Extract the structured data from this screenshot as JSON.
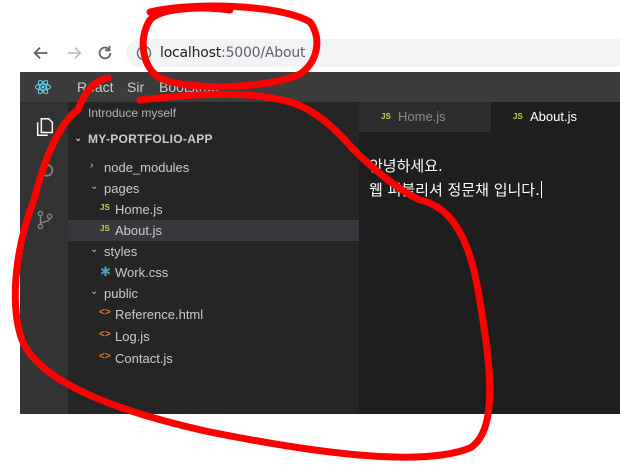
{
  "browser": {
    "url_host": "localhost",
    "url_path": ":5000/About"
  },
  "app": {
    "menu": [
      "React",
      "Sir",
      "Bootstrap"
    ],
    "sidebar_header": "Introduce myself",
    "project_title": "MY-PORTFOLIO-APP",
    "tree": [
      {
        "label": "node_modules",
        "type": "folder",
        "expanded": false
      },
      {
        "label": "pages",
        "type": "folder",
        "expanded": true
      },
      {
        "label": "Home.js",
        "type": "js"
      },
      {
        "label": "About.js",
        "type": "js",
        "selected": true
      },
      {
        "label": "styles",
        "type": "folder",
        "expanded": true
      },
      {
        "label": "Work.css",
        "type": "css"
      },
      {
        "label": "public",
        "type": "folder",
        "expanded": true
      },
      {
        "label": "Reference.html",
        "type": "html"
      },
      {
        "label": "Log.js",
        "type": "html"
      },
      {
        "label": "Contact.js",
        "type": "html"
      }
    ],
    "tabs": [
      {
        "label": "Home.js",
        "active": false
      },
      {
        "label": "About.js",
        "active": true
      }
    ],
    "content_lines": [
      "안녕하세요.",
      "웹 퍼블리셔 정문채 입니다."
    ]
  },
  "icons": {
    "back": "arrow-left-icon",
    "forward": "arrow-right-icon",
    "reload": "reload-icon",
    "info": "info-icon",
    "logo": "react-logo-icon",
    "explorer": "files-icon",
    "search": "search-icon",
    "scm": "source-control-icon",
    "js_badge": "JS",
    "css_badge": "✱",
    "html_badge": "<>"
  },
  "colors": {
    "annotation": "#ff0000",
    "js": "#cbcb41",
    "css": "#519aba",
    "html": "#e37933"
  }
}
